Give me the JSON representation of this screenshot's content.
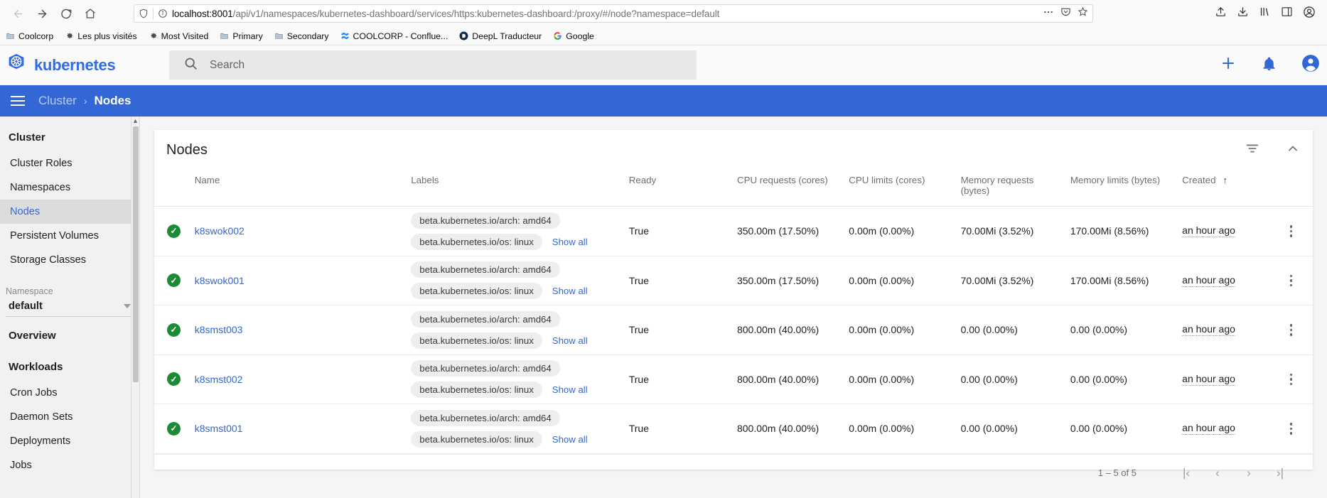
{
  "browser": {
    "nav_buttons": [
      {
        "name": "back",
        "glyph": "←"
      },
      {
        "name": "forward",
        "glyph": "→"
      },
      {
        "name": "reload",
        "glyph": "⟳"
      },
      {
        "name": "home",
        "glyph": "⌂"
      }
    ],
    "url": {
      "host": "localhost:8001",
      "path": "/api/v1/namespaces/kubernetes-dashboard/services/https:kubernetes-dashboard:/proxy/#/node?namespace=default",
      "shield_icon": "shield-icon",
      "info_icon": "info-icon",
      "more_icon": "ellipsis-icon",
      "pocket_icon": "pocket-icon",
      "bookmark_icon": "star-icon"
    },
    "toolbar_right": [
      {
        "name": "upload-icon",
        "glyph": "upload"
      },
      {
        "name": "download-icon",
        "glyph": "download"
      },
      {
        "name": "library-icon",
        "glyph": "library"
      },
      {
        "name": "sidebar-icon",
        "glyph": "sidebar"
      },
      {
        "name": "account-icon",
        "glyph": "account"
      }
    ],
    "bookmarks": [
      {
        "label": "Coolcorp",
        "icon": "folder-icon"
      },
      {
        "label": "Les plus visités",
        "icon": "gear-icon"
      },
      {
        "label": "Most Visited",
        "icon": "gear-icon"
      },
      {
        "label": "Primary",
        "icon": "folder-icon"
      },
      {
        "label": "Secondary",
        "icon": "folder-icon"
      },
      {
        "label": "COOLCORP - Conflue...",
        "icon": "confluence-icon"
      },
      {
        "label": "DeepL Traducteur",
        "icon": "deepl-icon"
      },
      {
        "label": "Google",
        "icon": "google-icon"
      }
    ]
  },
  "topbar": {
    "brand": "kubernetes",
    "brand_color": "#326ce5",
    "logo_icon": "kubernetes-helm-icon",
    "search_placeholder": "Search",
    "search_icon": "search-icon",
    "actions": [
      {
        "name": "create-button",
        "icon": "plus-icon"
      },
      {
        "name": "notifications-button",
        "icon": "bell-icon"
      },
      {
        "name": "account-button",
        "icon": "account-circle-icon"
      }
    ]
  },
  "breadcrumb": {
    "menu_icon": "hamburger-menu-icon",
    "parent": "Cluster",
    "separator": "›",
    "current": "Nodes",
    "bar_color": "#3367d6"
  },
  "sidebar": {
    "cluster_heading": "Cluster",
    "cluster_items": [
      {
        "label": "Cluster Roles",
        "active": false
      },
      {
        "label": "Namespaces",
        "active": false
      },
      {
        "label": "Nodes",
        "active": true
      },
      {
        "label": "Persistent Volumes",
        "active": false
      },
      {
        "label": "Storage Classes",
        "active": false
      }
    ],
    "namespace_label": "Namespace",
    "namespace_value": "default",
    "overview_heading": "Overview",
    "workloads_heading": "Workloads",
    "workload_items": [
      {
        "label": "Cron Jobs"
      },
      {
        "label": "Daemon Sets"
      },
      {
        "label": "Deployments"
      },
      {
        "label": "Jobs"
      }
    ]
  },
  "card": {
    "title": "Nodes",
    "filter_icon": "filter-icon",
    "collapse_icon": "chevron-up-icon",
    "columns": [
      {
        "key": "status",
        "label": ""
      },
      {
        "key": "name",
        "label": "Name"
      },
      {
        "key": "labels",
        "label": "Labels"
      },
      {
        "key": "ready",
        "label": "Ready"
      },
      {
        "key": "cpu_requests",
        "label": "CPU requests (cores)"
      },
      {
        "key": "cpu_limits",
        "label": "CPU limits (cores)"
      },
      {
        "key": "memory_requests",
        "label": "Memory requests (bytes)"
      },
      {
        "key": "memory_limits",
        "label": "Memory limits (bytes)"
      },
      {
        "key": "created",
        "label": "Created"
      },
      {
        "key": "menu",
        "label": ""
      }
    ],
    "sort_column": "Created",
    "sort_arrow": "↑",
    "show_all_label": "Show all",
    "rows": [
      {
        "status": "ready",
        "name": "k8swok002",
        "labels": [
          "beta.kubernetes.io/arch: amd64",
          "beta.kubernetes.io/os: linux"
        ],
        "ready": "True",
        "cpu_requests": "350.00m (17.50%)",
        "cpu_limits": "0.00m (0.00%)",
        "memory_requests": "70.00Mi (3.52%)",
        "memory_limits": "170.00Mi (8.56%)",
        "created": "an hour ago"
      },
      {
        "status": "ready",
        "name": "k8swok001",
        "labels": [
          "beta.kubernetes.io/arch: amd64",
          "beta.kubernetes.io/os: linux"
        ],
        "ready": "True",
        "cpu_requests": "350.00m (17.50%)",
        "cpu_limits": "0.00m (0.00%)",
        "memory_requests": "70.00Mi (3.52%)",
        "memory_limits": "170.00Mi (8.56%)",
        "created": "an hour ago"
      },
      {
        "status": "ready",
        "name": "k8smst003",
        "labels": [
          "beta.kubernetes.io/arch: amd64",
          "beta.kubernetes.io/os: linux"
        ],
        "ready": "True",
        "cpu_requests": "800.00m (40.00%)",
        "cpu_limits": "0.00m (0.00%)",
        "memory_requests": "0.00 (0.00%)",
        "memory_limits": "0.00 (0.00%)",
        "created": "an hour ago"
      },
      {
        "status": "ready",
        "name": "k8smst002",
        "labels": [
          "beta.kubernetes.io/arch: amd64",
          "beta.kubernetes.io/os: linux"
        ],
        "ready": "True",
        "cpu_requests": "800.00m (40.00%)",
        "cpu_limits": "0.00m (0.00%)",
        "memory_requests": "0.00 (0.00%)",
        "memory_limits": "0.00 (0.00%)",
        "created": "an hour ago"
      },
      {
        "status": "ready",
        "name": "k8smst001",
        "labels": [
          "beta.kubernetes.io/arch: amd64",
          "beta.kubernetes.io/os: linux"
        ],
        "ready": "True",
        "cpu_requests": "800.00m (40.00%)",
        "cpu_limits": "0.00m (0.00%)",
        "memory_requests": "0.00 (0.00%)",
        "memory_limits": "0.00 (0.00%)",
        "created": "an hour ago"
      }
    ],
    "pagination": {
      "range_label": "1 – 5 of 5",
      "first_glyph": "|‹",
      "prev_glyph": "‹",
      "next_glyph": "›",
      "last_glyph": "›|"
    }
  }
}
